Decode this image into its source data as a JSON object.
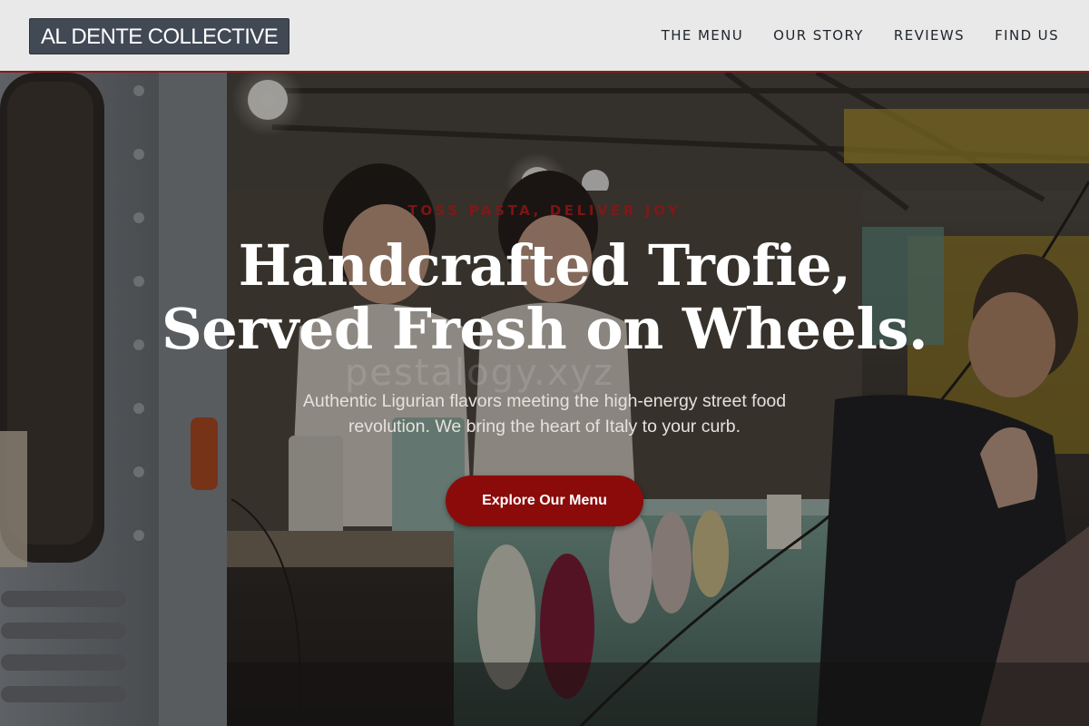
{
  "brand": {
    "logo_text": "AL DENTE COLLECTIVE"
  },
  "nav": {
    "items": [
      {
        "label": "THE MENU"
      },
      {
        "label": "OUR STORY"
      },
      {
        "label": "REVIEWS"
      },
      {
        "label": "FIND US"
      }
    ]
  },
  "hero": {
    "tagline": "TOSS PASTA, DELIVER JOY",
    "headline_line1": "Handcrafted Trofie,",
    "headline_line2": "Served Fresh on Wheels.",
    "subtitle": "Authentic Ligurian flavors meeting the high-energy street food revolution. We bring the heart of Italy to your curb.",
    "cta_label": "Explore Our Menu",
    "watermark_text": "pestalogy.xyz"
  },
  "colors": {
    "accent": "#8b0b0b",
    "header_bg": "#e9e9e9",
    "logo_bg": "#414955",
    "header_border": "#8b1a1a"
  }
}
